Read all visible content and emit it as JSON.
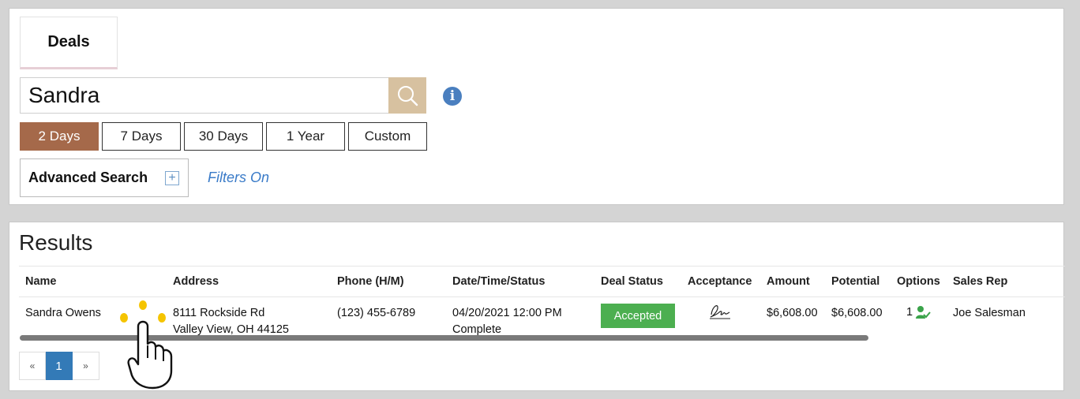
{
  "tabs": {
    "deals_label": "Deals"
  },
  "search": {
    "value": "Sandra"
  },
  "date_ranges": [
    {
      "label": "2 Days",
      "active": true
    },
    {
      "label": "7 Days",
      "active": false
    },
    {
      "label": "30 Days",
      "active": false
    },
    {
      "label": "1 Year",
      "active": false
    },
    {
      "label": "Custom",
      "active": false
    }
  ],
  "advanced_search": {
    "label": "Advanced Search",
    "filters_label": "Filters On"
  },
  "results": {
    "title": "Results",
    "columns": [
      "Name",
      "Address",
      "Phone (H/M)",
      "Date/Time/Status",
      "Deal Status",
      "Acceptance",
      "Amount",
      "Potential",
      "Options",
      "Sales Rep"
    ],
    "rows": [
      {
        "name": "Sandra Owens",
        "address_line1": "8111 Rockside Rd",
        "address_line2": "Valley View, OH 44125",
        "phone": "(123) 455-6789",
        "datetime": "04/20/2021 12:00 PM",
        "status": "Complete",
        "deal_status": "Accepted",
        "amount": "$6,608.00",
        "potential": "$6,608.00",
        "options_count": "1",
        "sales_rep": "Joe Salesman"
      }
    ]
  },
  "pagination": {
    "prev": "«",
    "current": "1",
    "next": "»"
  },
  "colors": {
    "active_range": "#a5694a",
    "search_button": "#d7c1a0",
    "accepted": "#4caf50",
    "link": "#3a7bc8",
    "page_active": "#337ab7"
  },
  "icons": [
    "search-icon",
    "info-icon",
    "plus-icon",
    "signature-icon",
    "user-check-icon",
    "tap-hand-icon"
  ]
}
